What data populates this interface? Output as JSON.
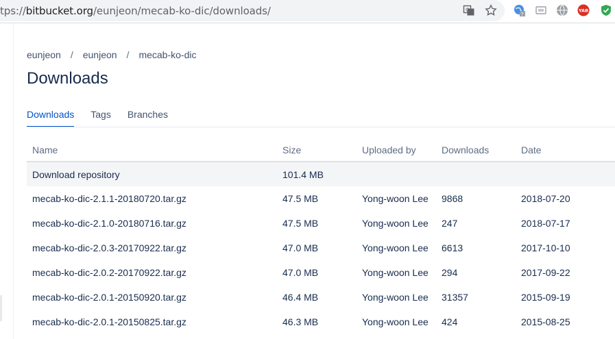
{
  "browser": {
    "url_prefix": "tps://",
    "url_host": "bitbucket.org",
    "url_path": "/eunjeon/mecab-ko-dic/downloads/"
  },
  "breadcrumb": [
    "eunjeon",
    "eunjeon",
    "mecab-ko-dic"
  ],
  "page": {
    "title": "Downloads"
  },
  "tabs": [
    {
      "label": "Downloads",
      "active": true
    },
    {
      "label": "Tags",
      "active": false
    },
    {
      "label": "Branches",
      "active": false
    }
  ],
  "table": {
    "headers": {
      "name": "Name",
      "size": "Size",
      "uploaded_by": "Uploaded by",
      "downloads": "Downloads",
      "date": "Date"
    },
    "repo_row": {
      "name": "Download repository",
      "size": "101.4 MB"
    },
    "rows": [
      {
        "name": "mecab-ko-dic-2.1.1-20180720.tar.gz",
        "size": "47.5 MB",
        "uploaded_by": "Yong-woon Lee",
        "downloads": "9868",
        "date": "2018-07-20"
      },
      {
        "name": "mecab-ko-dic-2.1.0-20180716.tar.gz",
        "size": "47.5 MB",
        "uploaded_by": "Yong-woon Lee",
        "downloads": "247",
        "date": "2018-07-17"
      },
      {
        "name": "mecab-ko-dic-2.0.3-20170922.tar.gz",
        "size": "47.0 MB",
        "uploaded_by": "Yong-woon Lee",
        "downloads": "6613",
        "date": "2017-10-10"
      },
      {
        "name": "mecab-ko-dic-2.0.2-20170922.tar.gz",
        "size": "47.0 MB",
        "uploaded_by": "Yong-woon Lee",
        "downloads": "294",
        "date": "2017-09-22"
      },
      {
        "name": "mecab-ko-dic-2.0.1-20150920.tar.gz",
        "size": "46.4 MB",
        "uploaded_by": "Yong-woon Lee",
        "downloads": "31357",
        "date": "2015-09-19"
      },
      {
        "name": "mecab-ko-dic-2.0.1-20150825.tar.gz",
        "size": "46.3 MB",
        "uploaded_by": "Yong-woon Lee",
        "downloads": "424",
        "date": "2015-08-25"
      }
    ]
  },
  "extensions": {
    "adblock_badge": "YAB"
  },
  "colors": {
    "accent": "#0052cc",
    "text": "#172b4d",
    "muted": "#5e6c84",
    "repo_row_bg": "#f4f5f7"
  }
}
